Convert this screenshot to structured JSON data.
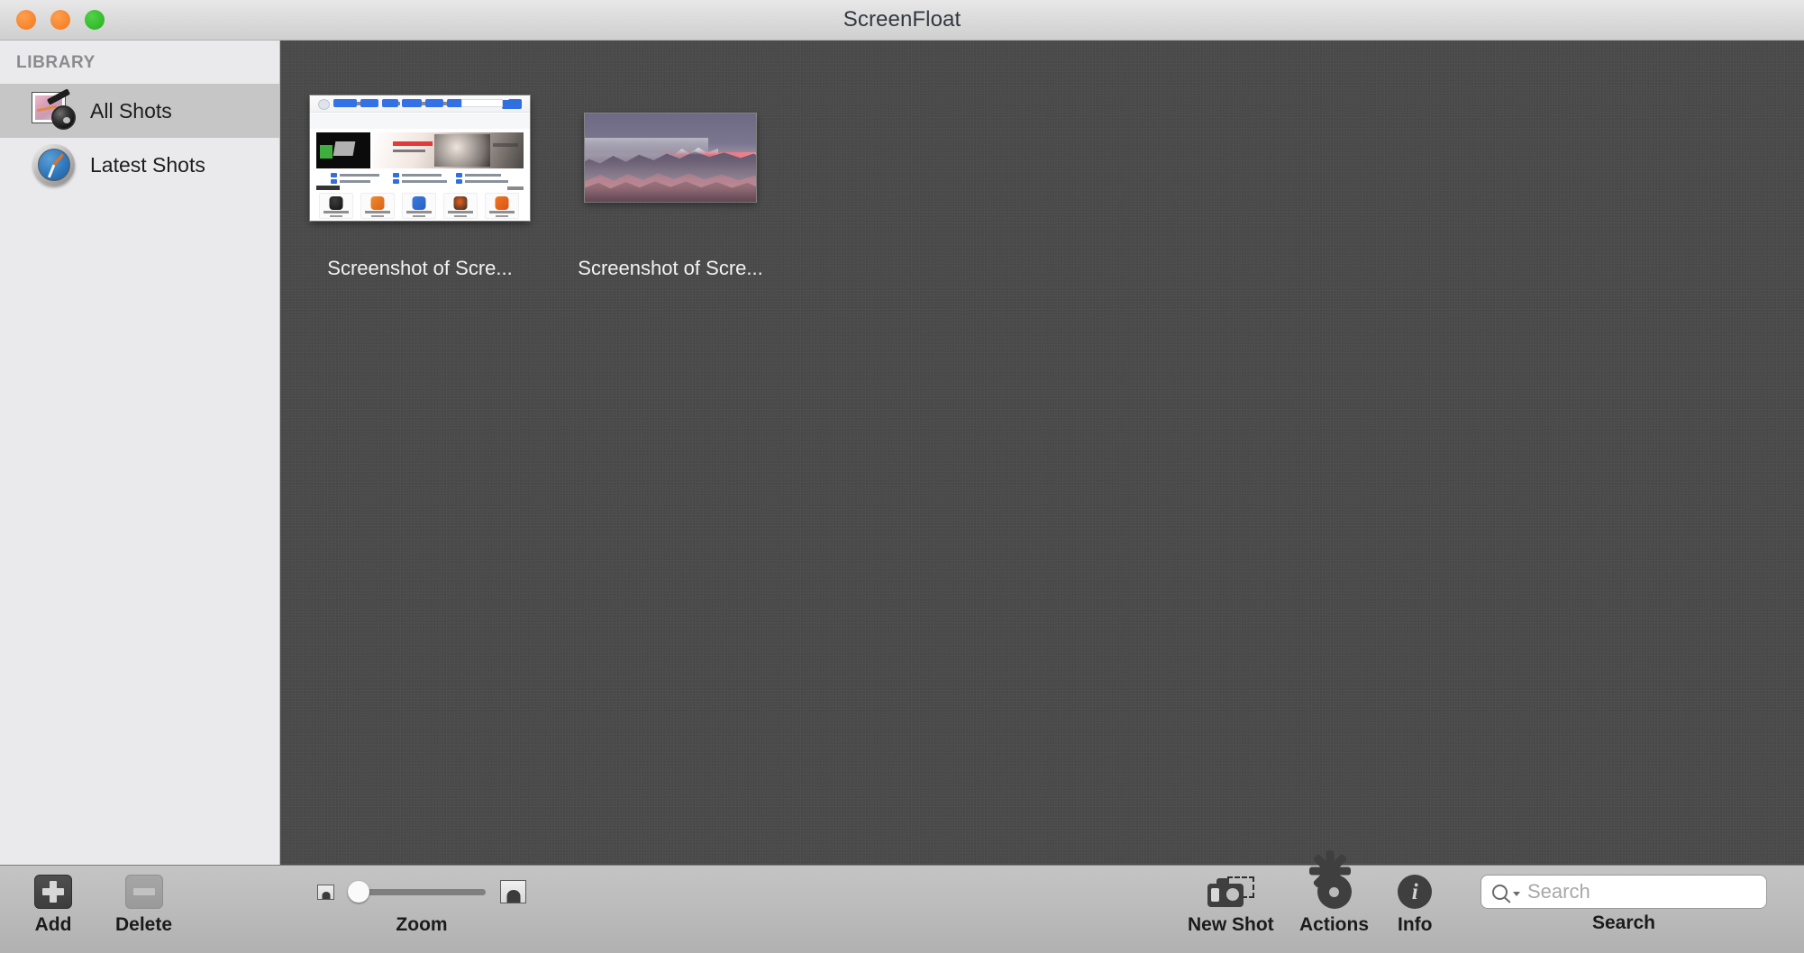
{
  "window": {
    "title": "ScreenFloat",
    "controls": [
      {
        "name": "close-button",
        "color": "#f58026"
      },
      {
        "name": "minimize-button",
        "color": "#f58026"
      },
      {
        "name": "maximize-button",
        "color": "#2fb728"
      }
    ]
  },
  "sidebar": {
    "header": "LIBRARY",
    "items": [
      {
        "label": "All Shots",
        "icon": "photo-camera-icon",
        "selected": true
      },
      {
        "label": "Latest Shots",
        "icon": "compass-clock-icon",
        "selected": false
      }
    ]
  },
  "main": {
    "shots": [
      {
        "label": "Screenshot of Scre...",
        "thumbnail": "webpage-thumbnail",
        "selected": true
      },
      {
        "label": "Screenshot of Scre...",
        "thumbnail": "landscape-thumbnail",
        "selected": false
      }
    ]
  },
  "toolbar": {
    "add": {
      "label": "Add",
      "icon": "plus-icon",
      "enabled": true
    },
    "delete": {
      "label": "Delete",
      "icon": "minus-icon",
      "enabled": false
    },
    "zoom": {
      "label": "Zoom",
      "value": 7,
      "min": 0,
      "max": 100,
      "small_icon": "small-picture-icon",
      "large_icon": "large-picture-icon"
    },
    "new_shot": {
      "label": "New Shot",
      "icon": "camera-selection-icon"
    },
    "actions": {
      "label": "Actions",
      "icon": "gear-icon"
    },
    "info": {
      "label": "Info",
      "icon": "info-circle-icon"
    },
    "search": {
      "label": "Search",
      "placeholder": "Search",
      "value": "",
      "icon": "search-icon"
    }
  },
  "colors": {
    "content_background": "#4a4a4a",
    "sidebar_background": "#eaeaec",
    "sidebar_selected": "#c6c6c6",
    "toolbar_background": "#bdbdbd",
    "accent_blue": "#2f6fe0"
  }
}
